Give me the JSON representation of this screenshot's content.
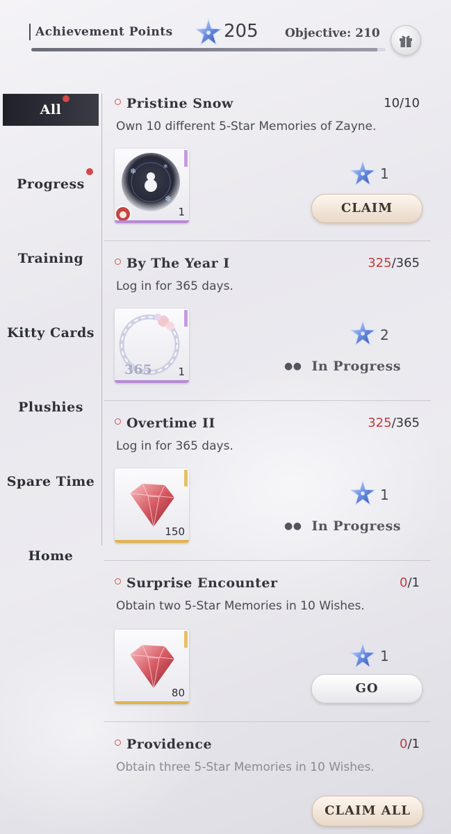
{
  "header": {
    "title": "Achievement Points",
    "points": "205",
    "objective_label": "Objective: 210",
    "progress_fraction": 0.976,
    "icons": {
      "points": "blue-star-icon",
      "gift": "gift-icon"
    }
  },
  "sidebar": {
    "items": [
      {
        "label": "All",
        "active": true,
        "badge": true
      },
      {
        "label": "Progress",
        "active": false,
        "badge": true
      },
      {
        "label": "Training",
        "active": false,
        "badge": false
      },
      {
        "label": "Kitty Cards",
        "active": false,
        "badge": false
      },
      {
        "label": "Plushies",
        "active": false,
        "badge": false
      },
      {
        "label": "Spare Time",
        "active": false,
        "badge": false
      },
      {
        "label": "Home",
        "active": false,
        "badge": false
      }
    ]
  },
  "achievements": [
    {
      "title": "Pristine Snow",
      "current": "10",
      "total": "/10",
      "description": "Own 10 different 5-Star Memories of Zayne.",
      "reward_item": {
        "icon": "snowman-emblem-icon",
        "qty": "1",
        "rarity_color": "#b78ad6"
      },
      "star_reward": "1",
      "action": "CLAIM"
    },
    {
      "title": "By The Year I",
      "current": "325",
      "total": "/365",
      "description": "Log in for 365 days.",
      "reward_item": {
        "icon": "floral-frame-icon",
        "qty": "1",
        "rarity_color": "#b78ad6"
      },
      "star_reward": "2",
      "action": "In Progress"
    },
    {
      "title": "Overtime II",
      "current": "325",
      "total": "/365",
      "description": "Log in for 365 days.",
      "reward_item": {
        "icon": "red-diamond-icon",
        "qty": "150",
        "rarity_color": "#e3b24a"
      },
      "star_reward": "1",
      "action": "In Progress"
    },
    {
      "title": "Surprise Encounter",
      "current": "0",
      "total": "/1",
      "description": "Obtain two 5-Star Memories in 10 Wishes.",
      "reward_item": {
        "icon": "red-diamond-icon",
        "qty": "80",
        "rarity_color": "#e3b24a"
      },
      "star_reward": "1",
      "action": "GO"
    },
    {
      "title": "Providence",
      "current": "0",
      "total": "/1",
      "description": "Obtain three 5-Star Memories in 10 Wishes."
    }
  ],
  "footer": {
    "claim_all_label": "CLAIM ALL"
  },
  "colors": {
    "accent_red": "#c23c3c",
    "sidebar_active": "#2a2b33",
    "claim_button": "#efe2d4"
  },
  "frame_text": "365"
}
